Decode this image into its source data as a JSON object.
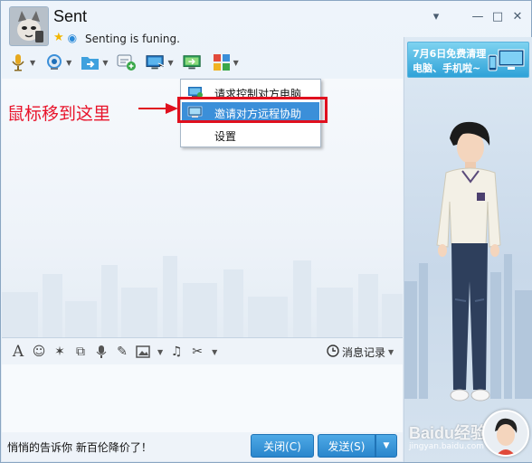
{
  "window": {
    "title": "Sent",
    "signature": "Senting is funing.",
    "controls": [
      "▾",
      "—",
      "□",
      "✕"
    ]
  },
  "toolbar": {
    "items": [
      {
        "icon": "microphone-icon"
      },
      {
        "icon": "camera-icon"
      },
      {
        "icon": "file-transfer-icon"
      },
      {
        "icon": "add-chat-icon"
      },
      {
        "icon": "remote-assistance-icon"
      },
      {
        "icon": "screen-share-icon"
      },
      {
        "icon": "apps-icon"
      }
    ]
  },
  "menu": {
    "items": [
      {
        "label": "请求控制对方电脑",
        "active": false
      },
      {
        "label": "邀请对方远程协助",
        "active": true
      },
      {
        "label": "设置",
        "active": false
      }
    ]
  },
  "annotation": {
    "text": "鼠标移到这里",
    "color": "#e8142b"
  },
  "ad": {
    "line1": "7月6日免费清理",
    "line2": "电脑、手机啦~"
  },
  "format_toolbar": {
    "history_label": "消息记录"
  },
  "bottom": {
    "ad_text": "悄悄的告诉你 新百伦降价了！",
    "close_label": "关闭(C)",
    "send_label": "发送(S)"
  },
  "watermark": {
    "text": "Baidu经验",
    "sub": "jingyan.baidu.com"
  },
  "colors": {
    "accent": "#3b8fd9",
    "button": "#2a86cc",
    "highlight_border": "#e0101e"
  }
}
